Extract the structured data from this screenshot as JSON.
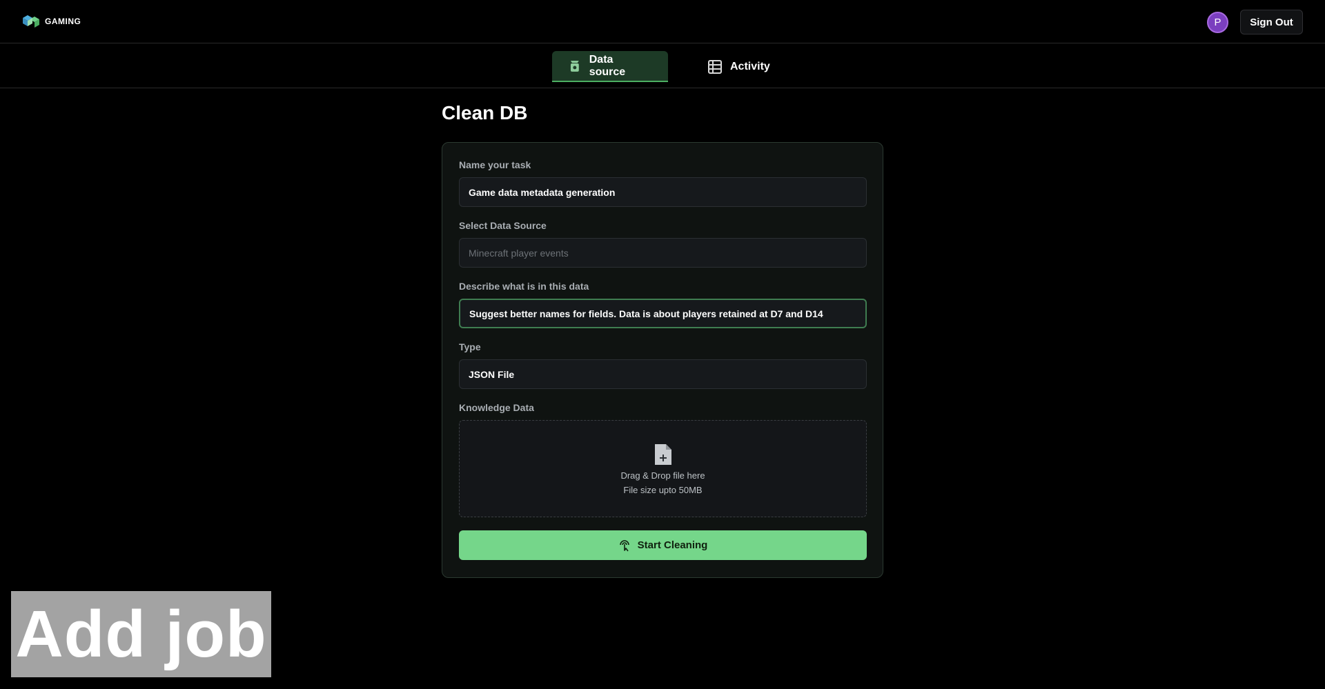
{
  "header": {
    "logo_text": "GAMING",
    "avatar_letter": "P",
    "sign_out_label": "Sign Out"
  },
  "tabs": [
    {
      "label": "Data source",
      "icon": "data-source-icon",
      "active": true
    },
    {
      "label": "Activity",
      "icon": "activity-list-icon",
      "active": false
    }
  ],
  "page": {
    "title": "Clean DB"
  },
  "form": {
    "task_name": {
      "label": "Name your task",
      "value": "Game data metadata generation"
    },
    "data_source": {
      "label": "Select Data Source",
      "placeholder": "Minecraft player events"
    },
    "description": {
      "label": "Describe what is in this data",
      "value": "Suggest better names for fields. Data is about players retained at D7 and D14"
    },
    "type": {
      "label": "Type",
      "value": "JSON File"
    },
    "knowledge": {
      "label": "Knowledge Data",
      "drop_text": "Drag & Drop file here",
      "size_text": "File size upto 50MB"
    },
    "submit_label": "Start Cleaning"
  },
  "overlay": {
    "caption": "Add job"
  },
  "colors": {
    "accent_green": "#75d68a",
    "active_tab_bg": "#1d3a26",
    "avatar": "#7b3fbf"
  }
}
